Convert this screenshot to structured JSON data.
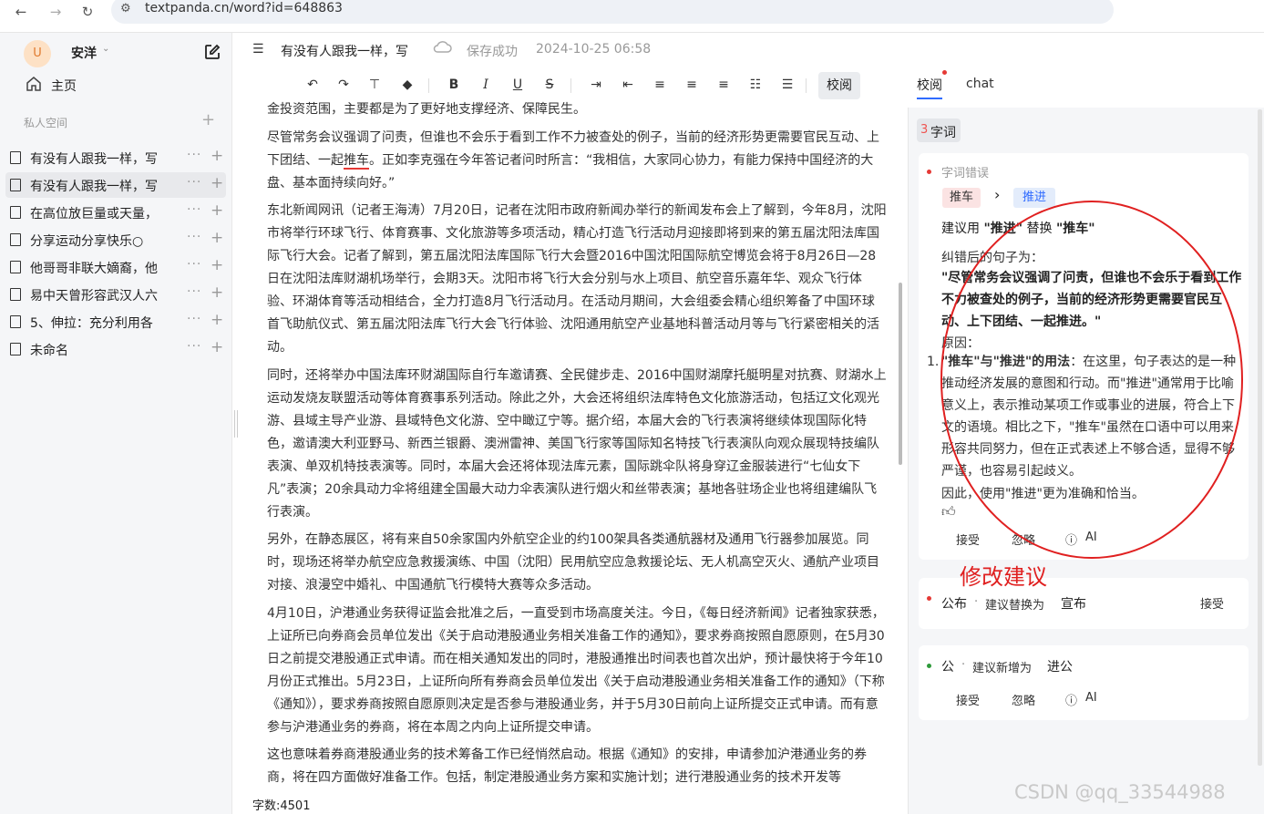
{
  "browser": {
    "url": "textpanda.cn/word?id=648863"
  },
  "sidebar": {
    "avatar_letter": "U",
    "username": "安洋",
    "home_label": "主页",
    "private_label": "私人空间",
    "docs": [
      {
        "label": "有没有人跟我一样，写"
      },
      {
        "label": "有没有人跟我一样，写"
      },
      {
        "label": "在高位放巨量或天量，"
      },
      {
        "label": "分享运动分享快乐○"
      },
      {
        "label": "他哥哥非联大嫡裔，他"
      },
      {
        "label": "易中天曾形容武汉人六"
      },
      {
        "label": "5、伸拉：充分利用各"
      },
      {
        "label": "未命名"
      }
    ],
    "more_glyph": "···",
    "plus_glyph": "+"
  },
  "header": {
    "doc_title": "有没有人跟我一样，写",
    "save_status": "保存成功",
    "save_time": "2024-10-25 06:58"
  },
  "toolbar": {
    "review_label": "校阅"
  },
  "editor": {
    "p0": "金投资范围，主要都是为了更好地支撑经济、保障民生。",
    "p1_a": "尽管常务会议强调了问责，但谁也不会乐于看到工作不力被查处的例子，当前的经济形势更需要官民互动、上下团结、一起",
    "p1_err": "推车",
    "p1_b": "。正如李克强在今年答记者问时所言：“我相信，大家同心协力，有能力保持中国经济的大盘、基本面持续向好。”",
    "p2": "东北新闻网讯（记者王海涛）7月20日，记者在沈阳市政府新闻办举行的新闻发布会上了解到，今年8月，沈阳市将举行环球飞行、体育赛事、文化旅游等多项活动，精心打造飞行活动月迎接即将到来的第五届沈阳法库国际飞行大会。记者了解到，第五届沈阳法库国际飞行大会暨2016中国沈阳国际航空博览会将于8月26日—28日在沈阳法库财湖机场举行，会期3天。沈阳市将飞行大会分别与水上项目、航空音乐嘉年华、观众飞行体验、环湖体育等活动相结合，全力打造8月飞行活动月。在活动月期间，大会组委会精心组织筹备了中国环球首飞助航仪式、第五届沈阳法库飞行大会飞行体验、沈阳通用航空产业基地科普活动月等与飞行紧密相关的活动。",
    "p3": "同时，还将举办中国法库环财湖国际自行车邀请赛、全民健步走、2016中国财湖摩托艇明星对抗赛、财湖水上运动发烧友联盟活动等体育赛事系列活动。除此之外，大会还将组织法库特色文化旅游活动，包括辽文化观光游、县域主导产业游、县域特色文化游、空中瞰辽宁等。据介绍，本届大会的飞行表演将继续体现国际化特色，邀请澳大利亚野马、新西兰银爵、澳洲雷神、美国飞行家等国际知名特技飞行表演队向观众展现特技编队表演、单双机特技表演等。同时，本届大会还将体现法库元素，国际跳伞队将身穿辽金服装进行“七仙女下凡”表演；20余具动力伞将组建全国最大动力伞表演队进行烟火和丝带表演；基地各驻场企业也将组建编队飞行表演。",
    "p4": "另外，在静态展区，将有来自50余家国内外航空企业的约100架具各类通航器材及通用飞行器参加展览。同时，现场还将举办航空应急救援演练、中国（沈阳）民用航空应急救援论坛、无人机高空灭火、通航产业项目对接、浪漫空中婚礼、中国通航飞行模特大赛等众多活动。",
    "p5": "4月10日，沪港通业务获得证监会批准之后，一直受到市场高度关注。今日，《每日经济新闻》记者独家获悉，上证所已向券商会员单位发出《关于启动港股通业务相关准备工作的通知》，要求券商按照自愿原则，在5月30日之前提交港股通正式申请。而在相关通知发出的同时，港股通推出时间表也首次出炉，预计最快将于今年10月份正式推出。5月23日，上证所向所有券商会员单位发出《关于启动港股通业务相关准备工作的通知》（下称《通知》），要求券商按照自愿原则决定是否参与港股通业务，并于5月30日前向上证所提交正式申请。而有意参与沪港通业务的券商，将在本周之内向上证所提交申请。",
    "p6": "这也意味着券商港股通业务的技术筹备工作已经悄然启动。根据《通知》的安排，申请参加沪港通业务的券商，将在四方面做好准备工作。包括，制定港股通业务方案和实施计划；进行港股通业务的技术开发等",
    "word_count": "字数:4501"
  },
  "review": {
    "tab_review": "校阅",
    "tab_chat": "chat",
    "category_count": "3",
    "category_label": "字词",
    "card1": {
      "type_label": "字词错误",
      "old_word": "推车",
      "new_word": "推进",
      "suggest_prefix": "建议用 ",
      "suggest_new": "\"推进\"",
      "suggest_mid": " 替换 ",
      "suggest_old": "\"推车\"",
      "corrected_label": "纠错后的句子为：",
      "corrected_sentence": "\"尽管常务会议强调了问责，但谁也不会乐于看到工作不力被查处的例子，当前的经济形势更需要官民互动、上下团结、一起推进。\"",
      "reason_label": "原因：",
      "reason_num": "1.",
      "reason_bold": "\"推车\"与\"推进\"的用法",
      "reason_text": "：在这里，句子表达的是一种推动经济发展的意图和行动。而\"推进\"通常用于比喻意义上，表示推动某项工作或事业的进展，符合上下文的语境。相比之下，\"推车\"虽然在口语中可以用来形容共同努力，但在正式表述上不够合适，显得不够严谨，也容易引起歧义。",
      "conclusion": "因此，使用\"推进\"更为准确和恰当。",
      "accept": "接受",
      "ignore": "忽略",
      "ai": "AI"
    },
    "card2": {
      "word": "公布",
      "sep": "·",
      "suggest": "建议替换为",
      "target": "宣布",
      "accept": "接受"
    },
    "card3": {
      "word": "公",
      "sep": "·",
      "suggest": "建议新增为",
      "target": "进公",
      "accept": "接受",
      "ignore": "忽略",
      "ai": "AI"
    }
  },
  "annotation": {
    "label": "修改建议"
  },
  "watermark": "CSDN @qq_33544988",
  "colors": {
    "accent_blue": "#2f6bff",
    "error_red": "#e53935",
    "annotation_red": "#e02020",
    "ok_green": "#2e9a3a"
  }
}
